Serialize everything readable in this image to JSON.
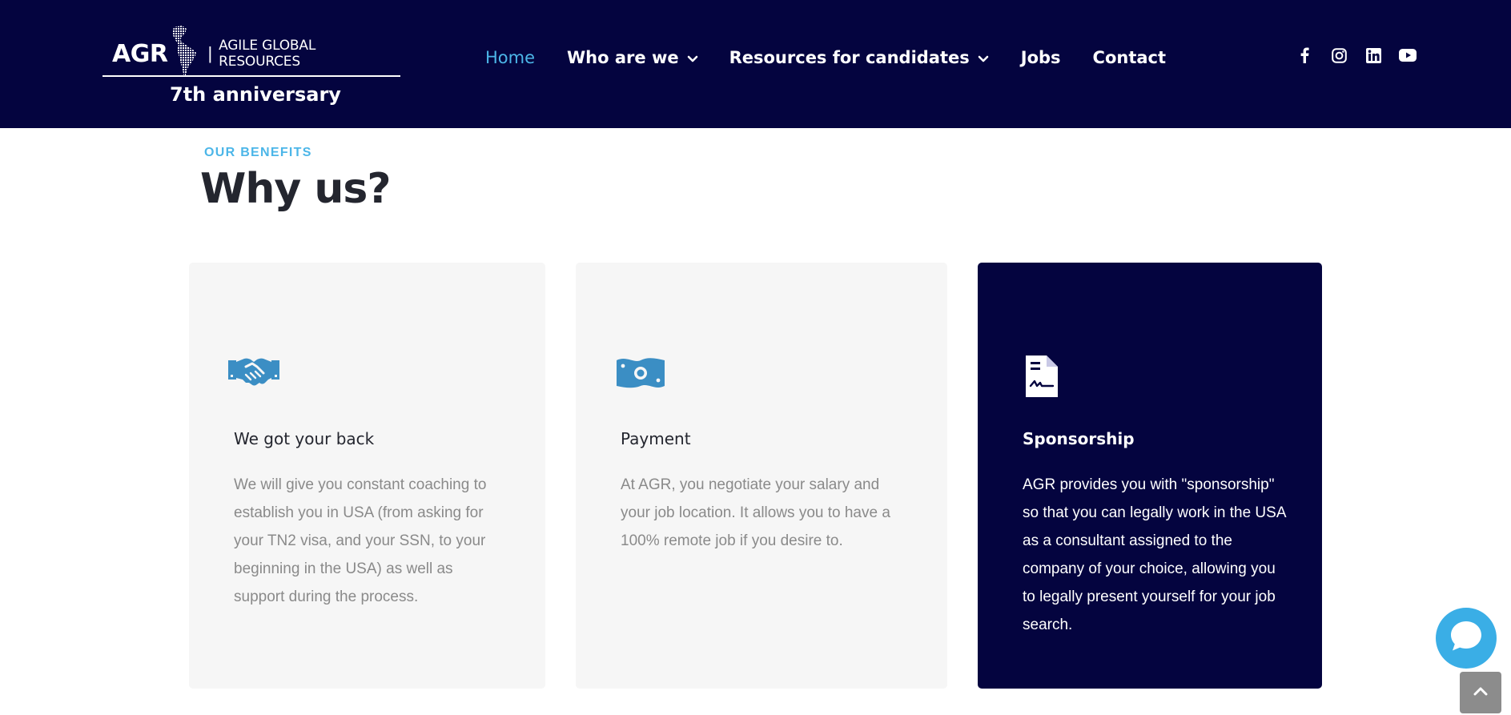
{
  "header": {
    "logo": {
      "abbr": "AGR",
      "separator": "|",
      "name": "AGILE GLOBAL RESOURCES",
      "anniversary": "7th anniversary"
    },
    "nav": [
      {
        "label": "Home",
        "active": true
      },
      {
        "label": "Who are we",
        "has_dropdown": true
      },
      {
        "label": "Resources for candidates",
        "has_dropdown": true
      },
      {
        "label": "Jobs"
      },
      {
        "label": "Contact"
      }
    ],
    "social_icons": [
      "facebook-icon",
      "instagram-icon",
      "linkedin-icon",
      "youtube-icon"
    ],
    "colors": {
      "background": "#04043f",
      "active_link": "#4cb6e8",
      "link": "#ffffff"
    }
  },
  "section": {
    "kicker": "OUR BENEFITS",
    "title": "Why us?"
  },
  "cards": [
    {
      "icon": "handshake-icon",
      "title": "We got your back",
      "text": "We will give you constant coaching to establish you in USA (from asking for your TN2 visa, and your SSN, to your beginning in the USA) as well as support during the process."
    },
    {
      "icon": "money-bill-icon",
      "title": "Payment",
      "text": "At AGR, you negotiate your salary and your job location. It allows you to have a 100% remote job if you desire to."
    },
    {
      "icon": "file-contract-icon",
      "title": "Sponsorship",
      "text": "AGR provides you with \"sponsorship\" so that you can legally work in the USA as a consultant assigned to the company of your choice, allowing you to legally present yourself for your job search.",
      "highlighted": true
    }
  ],
  "floating": {
    "chat_icon": "chat-bubble-icon",
    "scroll_top_icon": "chevron-up-icon"
  }
}
